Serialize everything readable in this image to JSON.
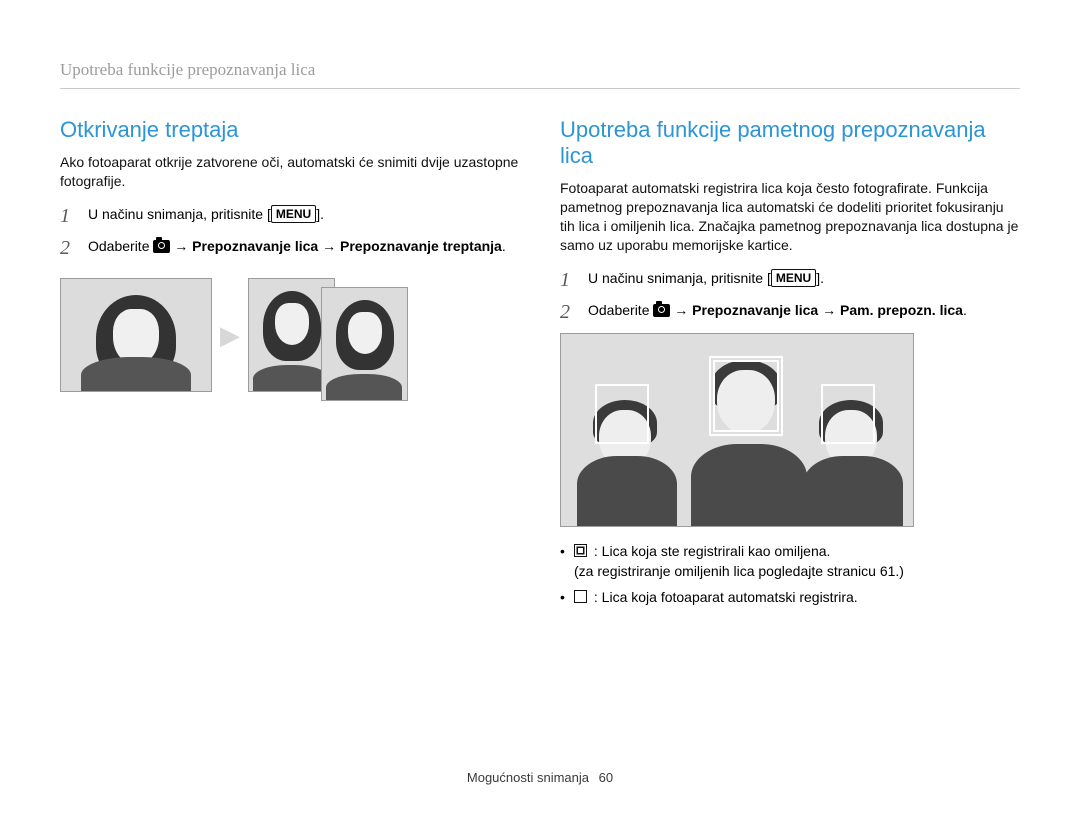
{
  "running_head": "Upotreba funkcije prepoznavanja lica",
  "left": {
    "title": "Otkrivanje treptaja",
    "intro": "Ako fotoaparat otkrije zatvorene oči, automatski će snimiti dvije uzastopne fotografije.",
    "step1_pre": "U načinu snimanja, pritisnite [",
    "step1_post": "].",
    "menu_label": "MENU",
    "step2_pre": "Odaberite ",
    "step2_arrow": " → ",
    "step2_b1": "Prepoznavanje lica",
    "step2_b2": "Prepoznavanje treptanja",
    "step2_post": "."
  },
  "right": {
    "title": "Upotreba funkcije pametnog prepoznavanja lica",
    "intro": "Fotoaparat automatski registrira lica koja često fotografirate. Funkcija pametnog prepoznavanja lica automatski će dodeliti prioritet fokusiranju tih lica i omiljenih lica. Značajka pametnog prepoznavanja lica dostupna je samo uz uporabu memorijske kartice.",
    "step1_pre": "U načinu snimanja, pritisnite [",
    "step1_post": "].",
    "menu_label": "MENU",
    "step2_pre": "Odaberite ",
    "step2_arrow": " → ",
    "step2_b1": "Prepoznavanje lica",
    "step2_b2": "Pam. prepozn. lica",
    "step2_post": ".",
    "bullet1_a": ": Lica koja ste registrirali kao omiljena.",
    "bullet1_b": "(za registriranje omiljenih lica pogledajte stranicu 61.)",
    "bullet2": ": Lica koja fotoaparat automatski registrira."
  },
  "footer_label": "Mogućnosti snimanja",
  "footer_page": "60"
}
